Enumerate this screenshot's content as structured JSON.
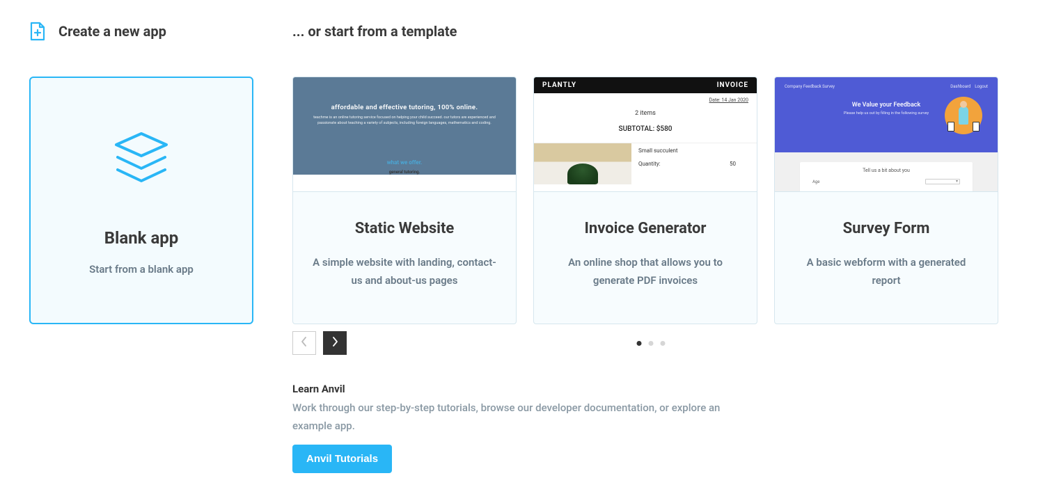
{
  "left": {
    "header": "Create a new app",
    "blank_card": {
      "title": "Blank app",
      "subtitle": "Start from a blank app"
    }
  },
  "right": {
    "header": "... or start from a template",
    "templates": [
      {
        "title": "Static Website",
        "description": "A simple website with landing, contact-us and about-us pages",
        "thumb": {
          "heroHeadline": "affordable and effective tutoring, 100% online.",
          "heroSub": "teachme is an online tutoring service focused on helping your child succeed. our tutors are experienced and passionate about teaching a variety of subjects, including foreign languages, mathematics and coding.",
          "offer": "what we offer.",
          "general": "general tutoring."
        }
      },
      {
        "title": "Invoice Generator",
        "description": "An online shop that allows you to generate PDF invoices",
        "thumb": {
          "brand": "PLANTLY",
          "label": "INVOICE",
          "date": "Date: 14 Jan 2020",
          "items": "2 items",
          "subtotal": "SUBTOTAL: $580",
          "itemName": "Small succulent",
          "qtyLabel": "Quantity:",
          "qtyValue": "50"
        }
      },
      {
        "title": "Survey Form",
        "description": "A basic webform with a generated report",
        "thumb": {
          "topLeft": "Company Feedback Survey",
          "topRightA": "Dashboard",
          "topRightB": "Logout",
          "heroTitle": "We Value your Feedback",
          "heroSub": "Please help us out by filling in the following survey",
          "formTitle": "Tell us a bit about you",
          "fieldLabel": "Age"
        }
      }
    ],
    "carousel": {
      "dot_count": 3,
      "active_dot": 0
    },
    "learn": {
      "heading": "Learn Anvil",
      "text": "Work through our step-by-step tutorials, browse our developer documentation, or explore an example app.",
      "button": "Anvil Tutorials"
    }
  }
}
